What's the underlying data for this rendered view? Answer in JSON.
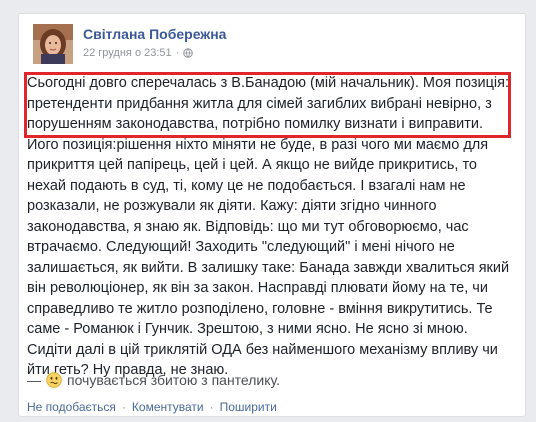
{
  "post": {
    "author": "Світлана Побережна",
    "timestamp": "22 грудня о 23:51",
    "privacy_icon": "globe-icon",
    "body_text": "Сьогодні довго сперечалась з В.Банадою (мій начальник). Моя позиція: претенденти придбання житла для сімей загиблих вибрані невірно, з порушенням законодавства, потрібно помилку визнати і виправити. Його позиція:рішення ніхто міняти не буде, в разі чого ми маємо для прикриття цей папірець, цей і цей. А якщо не вийде прикритись, то нехай подають в суд, ті, кому це не подобається. І взагалі нам не розказали, не розжували як діяти. Кажу: діяти згідно чинного законодавства, я знаю як. Відповідь: що ми тут обговорюємо, час втрачаємо. Следующий! Заходить \"следующий\" і мені нічого не залишається, як вийти. В залишку таке: Банада завжди хвалиться який він революціонер, як він за закон. Насправді плювати йому на те, чи справедливо те житло розподілено, головне - вміння викрутитись. Те саме - Романюк і Гунчик. Зрештою, з ними ясно. Не ясно зі мною. Сидіти далі в цій триклятій ОДА без найменшого механізму впливу чи йти геть? Ну правда, не знаю.",
    "feeling": {
      "dash": "—",
      "icon": "confused-emoji-icon",
      "text": "почувається збитою з пантелику."
    },
    "highlight_color": "#e0262b"
  },
  "actions": {
    "unlike": "Не подобається",
    "comment": "Коментувати",
    "share": "Поширити",
    "separator": "·"
  }
}
